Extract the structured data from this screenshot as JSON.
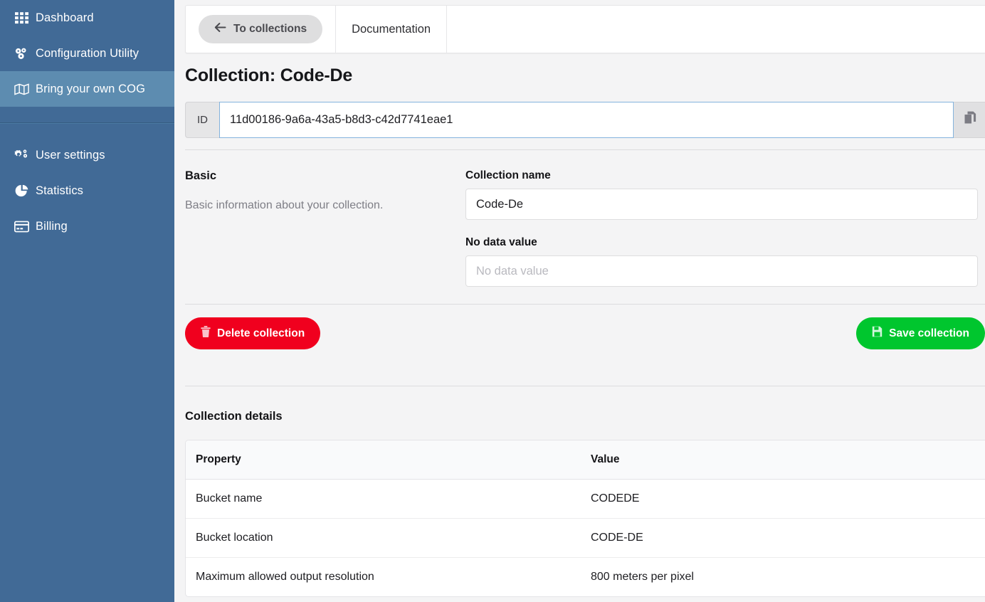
{
  "sidebar": {
    "items_primary": [
      {
        "label": "Dashboard",
        "icon": "grid-icon",
        "active": false
      },
      {
        "label": "Configuration Utility",
        "icon": "cogs-cluster-icon",
        "active": false
      },
      {
        "label": "Bring your own COG",
        "icon": "map-icon",
        "active": true
      }
    ],
    "items_secondary": [
      {
        "label": "User settings",
        "icon": "gears-icon",
        "active": false
      },
      {
        "label": "Statistics",
        "icon": "pie-chart-icon",
        "active": false
      },
      {
        "label": "Billing",
        "icon": "credit-card-icon",
        "active": false
      }
    ]
  },
  "tabs": [
    {
      "label": "To collections",
      "icon": "arrow-left-icon",
      "style": "pill"
    },
    {
      "label": "Documentation",
      "icon": "",
      "style": "plain"
    }
  ],
  "page": {
    "title": "Collection: Code-De"
  },
  "id_field": {
    "addon_label": "ID",
    "value": "11d00186-9a6a-43a5-b8d3-c42d7741eae1",
    "copy_icon": "copy-icon"
  },
  "basic": {
    "heading": "Basic",
    "description": "Basic information about your collection.",
    "collection_name": {
      "label": "Collection name",
      "value": "Code-De",
      "placeholder": "Collection name"
    },
    "no_data_value": {
      "label": "No data value",
      "value": "",
      "placeholder": "No data value"
    }
  },
  "actions": {
    "delete_label": "Delete collection",
    "delete_icon": "trash-icon",
    "delete_color": "#f0001e",
    "save_label": "Save collection",
    "save_icon": "save-icon",
    "save_color": "#00c62e"
  },
  "details": {
    "heading": "Collection details",
    "columns": [
      "Property",
      "Value"
    ],
    "rows": [
      {
        "property": "Bucket name",
        "value": "CODEDE"
      },
      {
        "property": "Bucket location",
        "value": "CODE-DE"
      },
      {
        "property": "Maximum allowed output resolution",
        "value": "800 meters per pixel"
      }
    ]
  },
  "colors": {
    "sidebar_bg": "#416a96",
    "sidebar_active": "#5d8cb0",
    "page_bg": "#f4f4f5",
    "input_focus_border": "#84b3dd"
  }
}
